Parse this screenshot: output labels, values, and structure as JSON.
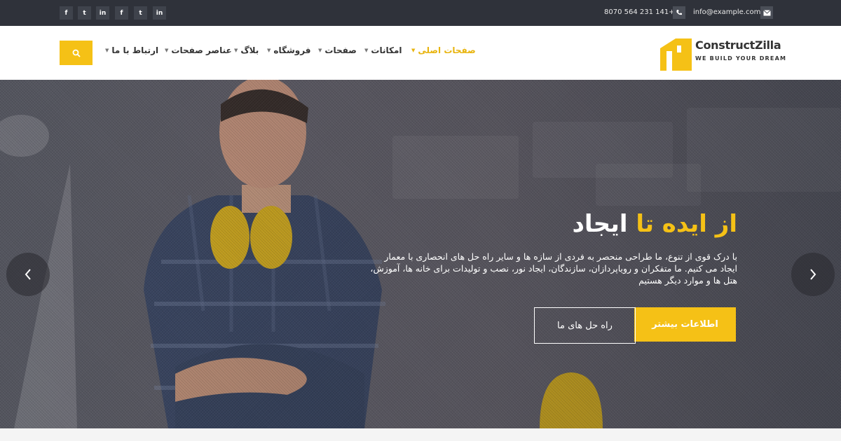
{
  "topbar": {
    "social_links": [
      {
        "name": "facebook",
        "glyph": "f"
      },
      {
        "name": "twitter",
        "glyph": "t"
      },
      {
        "name": "linkedin",
        "glyph": "in"
      },
      {
        "name": "facebook",
        "glyph": "f"
      },
      {
        "name": "twitter",
        "glyph": "t"
      },
      {
        "name": "linkedin",
        "glyph": "in"
      }
    ],
    "phone": "8070 564 231 141+",
    "email": "info@example.com"
  },
  "header": {
    "logo_brand": "ConstructZilla",
    "logo_tagline": "WE BUILD YOUR DREAM",
    "nav": [
      {
        "label": "صفحات اصلی",
        "active": true
      },
      {
        "label": "امکانات",
        "active": false
      },
      {
        "label": "صفحات",
        "active": false
      },
      {
        "label": "فروشگاه",
        "active": false
      },
      {
        "label": "بلاگ",
        "active": false
      },
      {
        "label": "عناصر صفحات",
        "active": false
      },
      {
        "label": "ارتباط با ما",
        "active": false
      }
    ]
  },
  "hero": {
    "title_highlight": "از ایده تا",
    "title_rest": "ایجاد",
    "description": "با درک قوی از تنوع، ما طراحی منحصر به فردی از سازه ها و سایر راه حل های انحصاری با معمار ایجاد می کنیم. ما متفکران و رویاپردازان، سازندگان، ایجاد نور، نصب و تولیدات برای خانه ها، آموزش، هتل ها و موارد دیگر هستیم",
    "primary_button": "اطلاعات بیشتر",
    "secondary_button": "راه حل های ما"
  },
  "colors": {
    "accent": "#f5c116",
    "topbar_bg": "#2f323a",
    "text_dark": "#333333"
  }
}
